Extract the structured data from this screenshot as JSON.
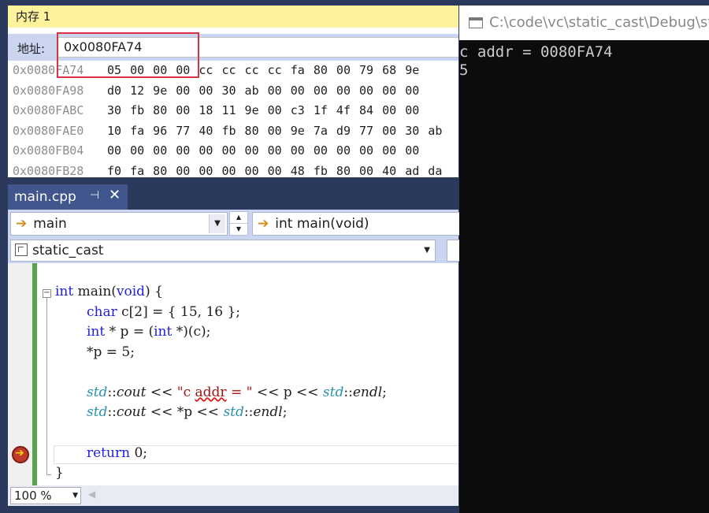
{
  "memory": {
    "title": "内存 1",
    "address_label": "地址:",
    "address_value": "0x0080FA74",
    "rows": [
      {
        "addr": "0x0080FA74",
        "bytes": "05 00 00 00 cc cc cc cc fa 80 00 79 68 9e"
      },
      {
        "addr": "0x0080FA98",
        "bytes": "d0 12 9e 00 00 30 ab 00 00 00 00 00 00 00"
      },
      {
        "addr": "0x0080FABC",
        "bytes": "30 fb 80 00 18 11 9e 00 c3 1f 4f 84 00 00"
      },
      {
        "addr": "0x0080FAE0",
        "bytes": "10 fa 96 77 40 fb 80 00 9e 7a d9 77 00 30 ab"
      },
      {
        "addr": "0x0080FB04",
        "bytes": "00 00 00 00 00 00 00 00 00 00 00 00 00 00"
      },
      {
        "addr": "0x0080FB28",
        "bytes": "f0 fa 80 00 00 00 00 00 48 fb 80 00 40 ad da"
      }
    ]
  },
  "editor": {
    "tab_label": "main.cpp",
    "pin_glyph": "⊣",
    "close_glyph": "✕",
    "scope_combo": "main",
    "function_combo": "int main(void)",
    "project_combo": "static_cast",
    "zoom": "100 %",
    "code": {
      "l1_kw": "int",
      "l1_rest": " main(",
      "l1_kw2": "void",
      "l1_end": ") {",
      "l2_kw": "char",
      "l2_rest": " c[2] = { 15, 16 };",
      "l3_kw": "int",
      "l3_mid": " * p = (",
      "l3_kw2": "int",
      "l3_end": " *)(c);",
      "l4": "*p = 5;",
      "l5_ns": "std",
      "l5_a": "::",
      "l5_cout": "cout",
      "l5_b": " << ",
      "l5_str1": "\"c ",
      "l5_str2": "addr",
      "l5_str3": " = \"",
      "l5_c": " << p << ",
      "l5_ns2": "std",
      "l5_d": "::",
      "l5_endl": "endl",
      "l5_e": ";",
      "l6_ns": "std",
      "l6_a": "::",
      "l6_cout": "cout",
      "l6_b": " << *p << ",
      "l6_ns2": "std",
      "l6_c": "::",
      "l6_endl": "endl",
      "l6_d": ";",
      "l7_kw": "return",
      "l7_rest": " 0;",
      "l8": "}"
    }
  },
  "console": {
    "title": "C:\\code\\vc\\static_cast\\Debug\\sta",
    "lines": [
      "c addr = 0080FA74",
      "5"
    ]
  }
}
